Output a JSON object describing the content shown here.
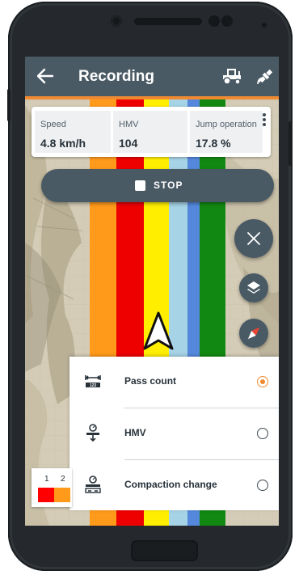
{
  "app": {
    "title": "Recording",
    "back_icon": "arrow-left-icon",
    "tractor_icon": "tractor-icon",
    "gnss_icon": "satellite-icon"
  },
  "info": {
    "cells": [
      {
        "label": "Speed",
        "value": "4.8 km/h"
      },
      {
        "label": "HMV",
        "value": "104"
      },
      {
        "label": "Jump operation",
        "value": "17.8 %"
      }
    ]
  },
  "stop_button": {
    "label": "STOP"
  },
  "map_controls": [
    "close-icon",
    "layers-icon",
    "compass-icon"
  ],
  "layers": {
    "options": [
      {
        "label": "Pass count",
        "icon": "pass-count-icon",
        "selected": true
      },
      {
        "label": "HMV",
        "icon": "hmv-icon",
        "selected": false
      },
      {
        "label": "Compaction change",
        "icon": "compaction-change-icon",
        "selected": false
      }
    ]
  },
  "legend": {
    "items": [
      {
        "label": "1",
        "color": "#ff0000"
      },
      {
        "label": "2",
        "color": "#ff9a1a"
      }
    ]
  },
  "colors": {
    "app_bar": "#4a5a65",
    "accent": "#f08a32",
    "lanes": [
      "#ff9a1a",
      "#ee0000",
      "#ffee00",
      "#a6d3e6",
      "#5588dd",
      "#118811"
    ]
  }
}
